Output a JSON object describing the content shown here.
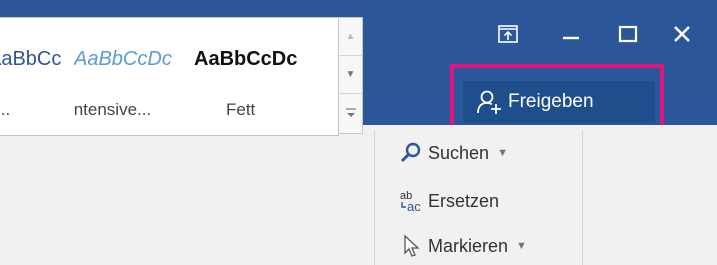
{
  "window_controls": {
    "display_options_icon": "ribbon-display-options-icon",
    "minimize_icon": "minimize-icon",
    "maximize_icon": "maximize-icon",
    "close_icon": "close-icon"
  },
  "share": {
    "label": "Freigeben",
    "icon": "person-add-icon",
    "highlight_color": "#e0157f"
  },
  "styles_gallery": {
    "items": [
      {
        "sample": "AaBbCcDc",
        "name": "..."
      },
      {
        "sample": "AaBbCcDc",
        "name": "Intensive..."
      },
      {
        "sample": "AaBbCcDc",
        "name": "Fett"
      }
    ]
  },
  "editing": {
    "search_label": "Suchen",
    "replace_label": "Ersetzen",
    "select_label": "Markieren"
  },
  "colors": {
    "titlebar": "#2b579a",
    "share_button": "#1e4e8c",
    "ribbon": "#f1f1f1"
  }
}
